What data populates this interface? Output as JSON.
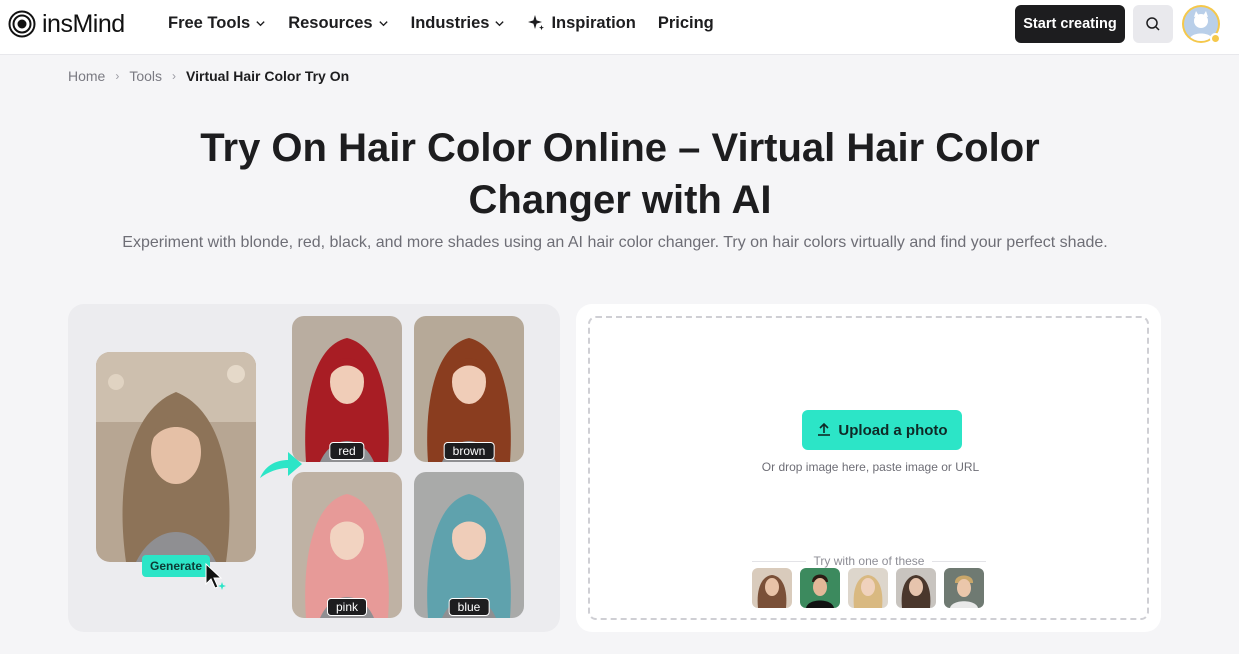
{
  "nav": {
    "brand": "insMind",
    "menu": [
      {
        "label": "Free Tools",
        "has_dropdown": true
      },
      {
        "label": "Resources",
        "has_dropdown": true
      },
      {
        "label": "Industries",
        "has_dropdown": true
      },
      {
        "label": "Inspiration",
        "has_dropdown": false,
        "icon": "sparkle-icon"
      },
      {
        "label": "Pricing",
        "has_dropdown": false
      }
    ],
    "cta": "Start creating",
    "search_icon": "search-icon",
    "avatar_icon": "user-avatar"
  },
  "breadcrumb": {
    "items": [
      "Home",
      "Tools"
    ],
    "current": "Virtual Hair Color Try On",
    "separator": "›"
  },
  "hero": {
    "title": "Try On Hair Color Online – Virtual Hair Color Changer with AI",
    "subtitle": "Experiment with blonde, red, black, and more shades using an AI hair color changer. Try on hair colors virtually and find your perfect shade."
  },
  "showcase": {
    "generate_label": "Generate",
    "variants": [
      {
        "label": "red",
        "hair_color": "#a81d24"
      },
      {
        "label": "brown",
        "hair_color": "#8a3d1f"
      },
      {
        "label": "pink",
        "hair_color": "#e79a98"
      },
      {
        "label": "blue",
        "hair_color": "#5fa2ad"
      }
    ],
    "original_hair_color": "#8d7358"
  },
  "upload": {
    "button_label": "Upload a photo",
    "hint": "Or drop image here, paste image or URL",
    "samples_label": "Try with one of these",
    "sample_count": 5
  },
  "colors": {
    "accent": "#2ce5c7",
    "dark": "#1d1d1f",
    "page_bg": "#f5f5f7"
  }
}
